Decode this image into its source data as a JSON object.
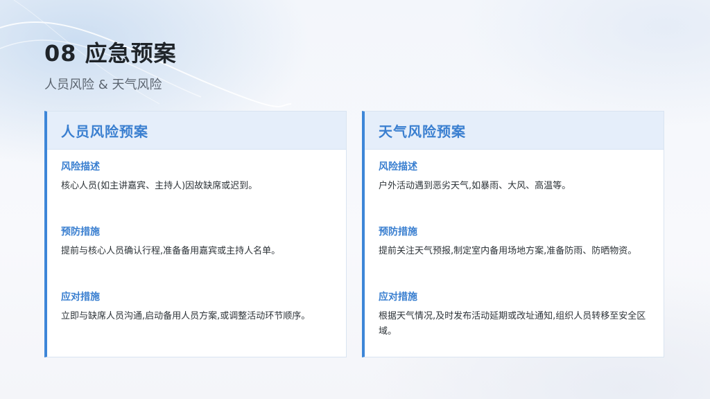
{
  "slide": {
    "title": "08 应急预案",
    "subtitle": "人员风险 & 天气风险"
  },
  "cards": [
    {
      "title": "人员风险预案",
      "sections": [
        {
          "label": "风险描述",
          "text": "核心人员(如主讲嘉宾、主持人)因故缺席或迟到。"
        },
        {
          "label": "预防措施",
          "text": "提前与核心人员确认行程,准备备用嘉宾或主持人名单。"
        },
        {
          "label": "应对措施",
          "text": "立即与缺席人员沟通,启动备用人员方案,或调整活动环节顺序。"
        }
      ]
    },
    {
      "title": "天气风险预案",
      "sections": [
        {
          "label": "风险描述",
          "text": "户外活动遇到恶劣天气,如暴雨、大风、高温等。"
        },
        {
          "label": "预防措施",
          "text": "提前关注天气预报,制定室内备用场地方案,准备防雨、防晒物资。"
        },
        {
          "label": "应对措施",
          "text": "根据天气情况,及时发布活动延期或改址通知,组织人员转移至安全区域。"
        }
      ]
    }
  ],
  "colors": {
    "accent": "#3d86d8",
    "title": "#1f2429",
    "header_bg": "#e5eefa"
  }
}
